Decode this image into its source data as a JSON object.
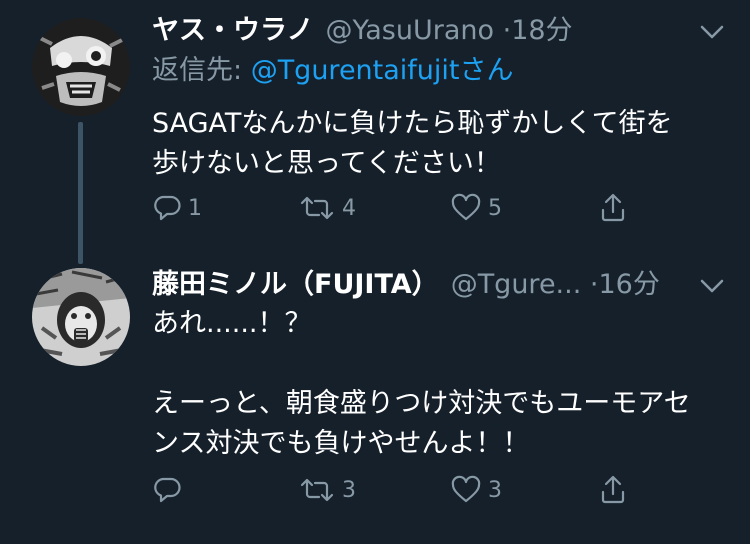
{
  "tweets": [
    {
      "author_name": "ヤス・ウラノ",
      "author_handle": "@YasuUrano",
      "separator": "·",
      "time": "18分",
      "reply_prefix": "返信先: ",
      "reply_mention": "@Tgurentaifujit",
      "reply_suffix": "さん",
      "text_lines": [
        "SAGATなんかに負けたら恥ずかしくて街を",
        "歩けないと思ってください！"
      ],
      "reply_count": "1",
      "retweet_count": "4",
      "like_count": "5"
    },
    {
      "author_name": "藤田ミノル（FUJITA）",
      "author_handle": "@Tgure...",
      "separator": "·",
      "time": "16分",
      "text_lines": [
        "あれ......！？",
        "",
        "えーっと、朝食盛りつけ対決でもユーモアセ",
        "ンス対決でも負けやせんよ！！"
      ],
      "reply_count": "",
      "retweet_count": "3",
      "like_count": "3"
    }
  ],
  "icons": {
    "more": "chevron-down-icon",
    "reply": "reply-icon",
    "retweet": "retweet-icon",
    "like": "heart-icon",
    "share": "share-icon"
  },
  "colors": {
    "background": "#15202b",
    "secondary_text": "#8899a6",
    "mention": "#1da1f2",
    "thread_line": "#3d5466"
  }
}
